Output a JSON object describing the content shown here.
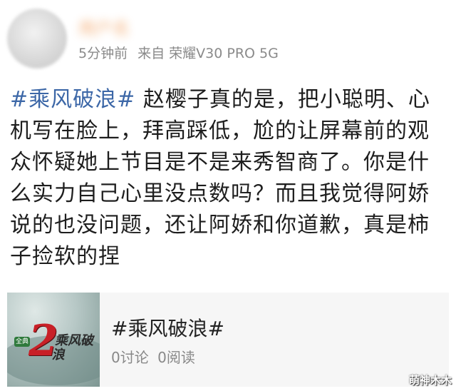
{
  "header": {
    "username": "用户名",
    "time": "5分钟前",
    "source": "来自 荣耀V30 PRO 5G"
  },
  "post": {
    "hashtag": "#乘风破浪#",
    "text": " 赵樱子真的是，把小聪明、心机写在脸上，拜高踩低，尬的让屏幕前的观众怀疑她上节目是不是来秀智商了。你是什么实力自己心里没点数吗？而且我觉得阿娇说的也没问题，还让阿娇和你道歉，真是柿子捡软的捏"
  },
  "topic_card": {
    "thumb_badge": "全典",
    "thumb_number": "2",
    "thumb_logo": "乘风破浪",
    "title": "#乘风破浪#",
    "discussions": "0讨论",
    "reads": "0阅读"
  },
  "watermark": "萌神木木",
  "colors": {
    "hashtag": "#3c67a7",
    "meta": "#8a8a8a",
    "card_background": "#f6f6f6"
  },
  "icons": {
    "avatar": "blurred-avatar"
  }
}
